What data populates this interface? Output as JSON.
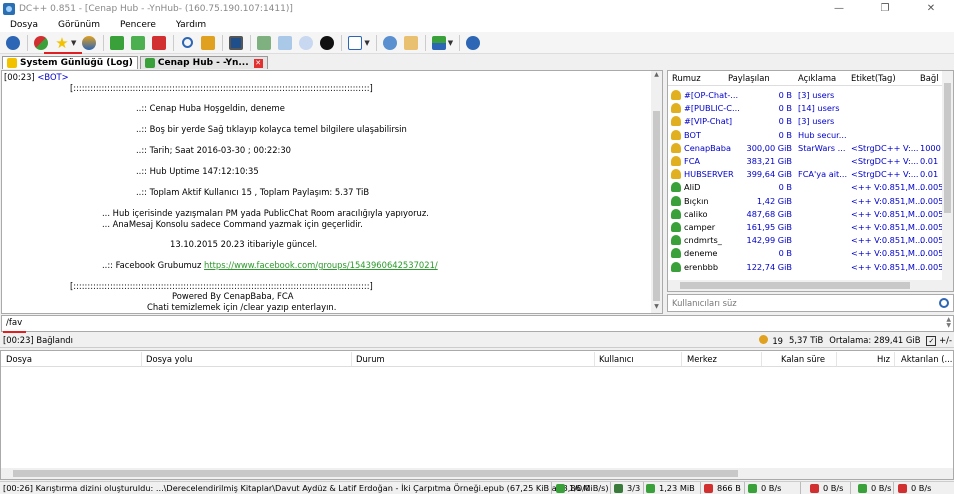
{
  "window": {
    "title": "DC++ 0.851 - [Cenap Hub - -YnHub- (160.75.190.107:1411)]",
    "minimize": "—",
    "restore": "❐",
    "close": "✕"
  },
  "menu": [
    "Dosya",
    "Görünüm",
    "Pencere",
    "Yardım"
  ],
  "toolbar": {
    "icons": [
      "globe-icon",
      "reconnect-icon",
      "favorite-hubs-icon",
      "favorite-users-icon",
      "upload-queue-icon",
      "download-queue-icon",
      "finished-icon",
      "search-icon",
      "adl-search-icon",
      "notepad-icon",
      "queue-icon",
      "waiting-users-icon",
      "netstats-icon",
      "open-filelist-icon",
      "settings-icon",
      "notes-icon",
      "network-icon",
      "help-icon"
    ],
    "colors": {
      "blue": "#2c66b5",
      "green": "#3aa03a",
      "red": "#d23030",
      "orange": "#e0a020",
      "yellow": "#f2c200"
    }
  },
  "tabs": [
    {
      "label": "System Günlüğü (Log)",
      "icon": "log-icon"
    },
    {
      "label": "Cenap Hub - -Yn...",
      "icon": "hub-icon"
    }
  ],
  "chat": {
    "first_ts": "[00:23]",
    "first_nick": "<BOT>",
    "lines": [
      "[:::::::::::::::::::::::::::::::::::::::::::::::::::::::::::::::::::::::::::::::::::::::::::::::::::::::::]",
      "..:: Cenap Huba Hoşgeldin, deneme",
      "..:: Boş bir yerde Sağ tıklayıp kolayca temel bilgilere ulaşabilirsin",
      "..:: Tarih; Saat  2016-03-30 ; 00:22:30",
      "..:: Hub Uptime 147:12:10:35",
      "..:: Toplam Aktif Kullanıcı 15 , Toplam Paylaşım: 5.37 TiB",
      "... Hub içerisinde yazışmaları PM yada PublicChat Room aracılığıyla yapıyoruz.",
      "... AnaMesaj Konsolu sadece Command yazmak için geçerlidir.",
      "13.10.2015 20.23  itibariyle güncel.",
      "..:: Facebook Grubumuz ",
      "[:::::::::::::::::::::::::::::::::::::::::::::::::::::::::::::::::::::::::::::::::::::::::::::::::::::::::]",
      "Powered By CenapBaba, FCA",
      "Chati temizlemek için /clear yazıp enterlayın."
    ],
    "facebook_link": "https://www.facebook.com/groups/1543960642537021/"
  },
  "userlist": {
    "columns": [
      "Rumuz",
      "Paylaşılan",
      "Açıklama",
      "Etiket(Tag)",
      "Bağl"
    ],
    "rows": [
      {
        "nick": "#[OP-Chat-...",
        "share": "0 B",
        "desc": "[3] users",
        "tag": "",
        "conn": "",
        "icon": "op-icon"
      },
      {
        "nick": "#[PUBLIC-C...",
        "share": "0 B",
        "desc": "[14] users",
        "tag": "",
        "conn": "",
        "icon": "op-icon"
      },
      {
        "nick": "#[VIP-Chat]",
        "share": "0 B",
        "desc": "[3] users",
        "tag": "",
        "conn": "",
        "icon": "op-icon"
      },
      {
        "nick": "BOT",
        "share": "0 B",
        "desc": "Hub secur...",
        "tag": "",
        "conn": "",
        "icon": "op-icon"
      },
      {
        "nick": "CenapBaba",
        "share": "300,00 GiB",
        "desc": "StarWars ...",
        "tag": "<StrgDC++ V:...",
        "conn": "1000",
        "icon": "op-icon"
      },
      {
        "nick": "FCA",
        "share": "383,21 GiB",
        "desc": "",
        "tag": "<StrgDC++ V:...",
        "conn": "0.01",
        "icon": "op-icon"
      },
      {
        "nick": "HUBSERVER",
        "share": "399,64 GiB",
        "desc": "FCA'ya ait...",
        "tag": "<StrgDC++ V:...",
        "conn": "0.01",
        "icon": "op-icon"
      },
      {
        "nick": "AliD",
        "share": "0 B",
        "desc": "",
        "tag": "<++ V:0.851,M...",
        "conn": "0.005",
        "icon": "user-icon"
      },
      {
        "nick": "Bıçkın",
        "share": "1,42 GiB",
        "desc": "",
        "tag": "<++ V:0.851,M...",
        "conn": "0.005",
        "icon": "user-icon"
      },
      {
        "nick": "caliko",
        "share": "487,68 GiB",
        "desc": "",
        "tag": "<++ V:0.851,M...",
        "conn": "0.005",
        "icon": "user-icon"
      },
      {
        "nick": "camper",
        "share": "161,95 GiB",
        "desc": "",
        "tag": "<++ V:0.851,M...",
        "conn": "0.005",
        "icon": "user-icon"
      },
      {
        "nick": "cndmrts_",
        "share": "142,99 GiB",
        "desc": "",
        "tag": "<++ V:0.851,M...",
        "conn": "0.005",
        "icon": "user-icon"
      },
      {
        "nick": "deneme",
        "share": "0 B",
        "desc": "",
        "tag": "<++ V:0.851,M...",
        "conn": "0.005",
        "icon": "user-icon"
      },
      {
        "nick": "erenbbb",
        "share": "122,74 GiB",
        "desc": "",
        "tag": "<++ V:0.851,M...",
        "conn": "0.005",
        "icon": "user-icon"
      }
    ],
    "search_placeholder": "Kullanıcıları süz"
  },
  "message_input": {
    "value": "/fav"
  },
  "status": {
    "left": "[00:23] Bağlandı",
    "users": "19",
    "share": "5,37 TiB",
    "average": "Ortalama: 289,41 GiB",
    "toggle": "+/-",
    "toggle_check": "✓"
  },
  "transfers": {
    "columns": [
      "Dosya",
      "Dosya yolu",
      "Durum",
      "Kullanıcı",
      "Merkez",
      "Kalan süre",
      "Hız",
      "Aktarılan (..."
    ]
  },
  "statusbar": {
    "message": "[00:26] Karıştırma dizini oluşturuldu: ...\\Derecelendirilmiş Kitaplar\\Davut Aydüz & Latif Erdoğan - İki Çarpıtma Örneği.epub (67,25 KiB at 3,86 MiB/s)",
    "hubs": "1/0/0",
    "slots": "3/3",
    "downloaded": "1,23 MiB",
    "uploaded": "866 B",
    "down_speed": "0 B/s",
    "up_speed": "0 B/s",
    "down_limit": "0 B/s",
    "up_limit": "0 B/s"
  }
}
